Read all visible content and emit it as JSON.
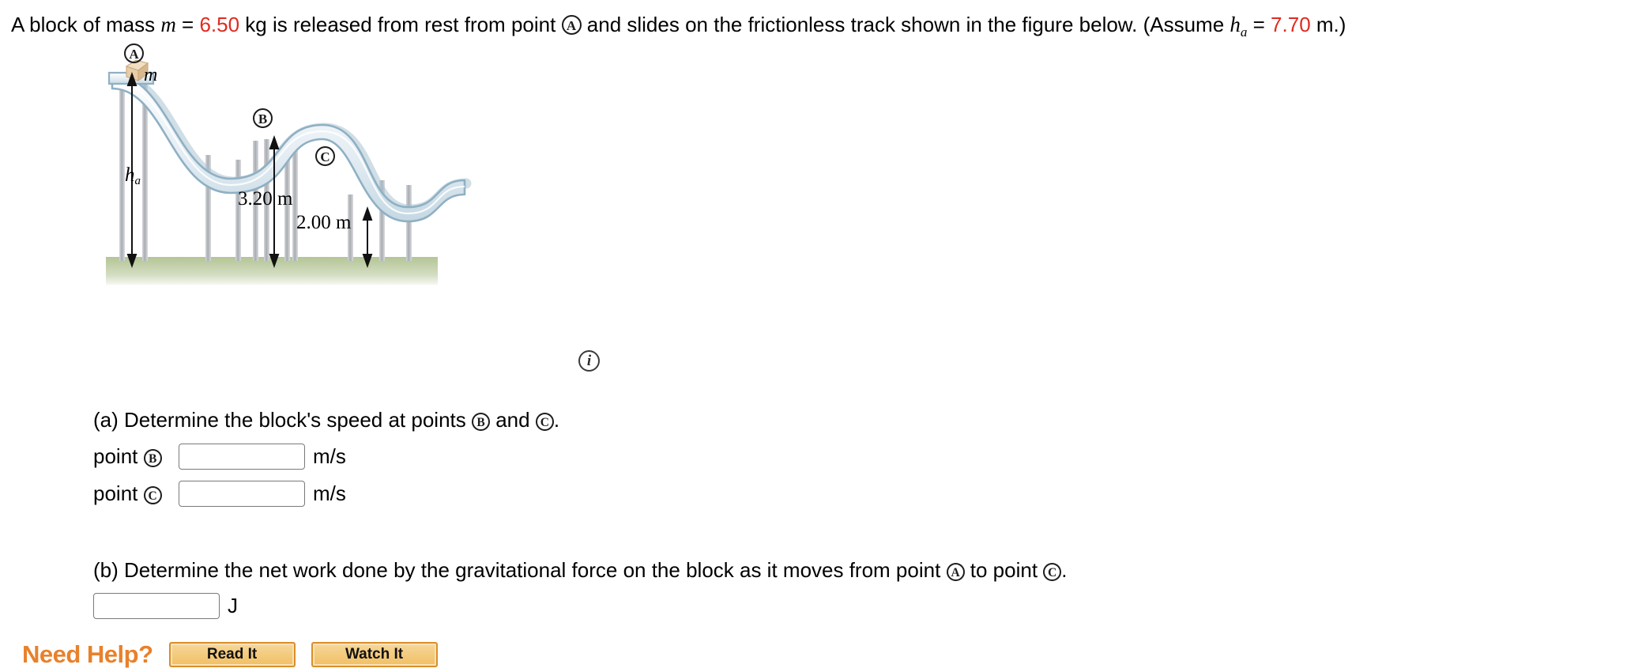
{
  "problem": {
    "stem_part1": "A block of mass ",
    "stem_m_symbol": "m",
    "stem_eq1": " = ",
    "stem_mass_value": "6.50",
    "stem_part2": " kg is released from rest from point ",
    "stem_point_a": "A",
    "stem_part3": " and slides on the frictionless track shown in the figure below. (Assume ",
    "stem_h_symbol": "h",
    "stem_h_sub": "a",
    "stem_eq2": " = ",
    "stem_ha_value": "7.70",
    "stem_part4": " m.)"
  },
  "figure": {
    "label_a": "A",
    "label_b": "B",
    "label_c": "C",
    "mass_label": "m",
    "height_a_label": "h",
    "height_a_sub": "a",
    "height_b_label": "3.20 m",
    "height_c_label": "2.00 m",
    "info_icon": "i",
    "colors": {
      "track_fill": "#dde8ee",
      "track_edge": "#8fb0c4",
      "ground": "#b7c89a",
      "block": "#e8ceab",
      "post": "#b9bcc0"
    }
  },
  "part_a": {
    "prompt_pre": "(a) Determine the block's speed at points ",
    "prompt_point1": "B",
    "prompt_mid": " and ",
    "prompt_point2": "C",
    "prompt_post": ".",
    "rows": [
      {
        "label_pre": "point ",
        "point": "B",
        "value": "",
        "placeholder": "",
        "unit": "m/s"
      },
      {
        "label_pre": "point ",
        "point": "C",
        "value": "",
        "placeholder": "",
        "unit": "m/s"
      }
    ]
  },
  "part_b": {
    "prompt_pre": "(b) Determine the net work done by the gravitational force on the block as it moves from point ",
    "prompt_point1": "A",
    "prompt_mid": " to point ",
    "prompt_point2": "C",
    "prompt_post": ".",
    "value": "",
    "placeholder": "",
    "unit": "J"
  },
  "need_help": {
    "title": "Need Help?",
    "read_it": "Read It",
    "watch_it": "Watch It"
  }
}
